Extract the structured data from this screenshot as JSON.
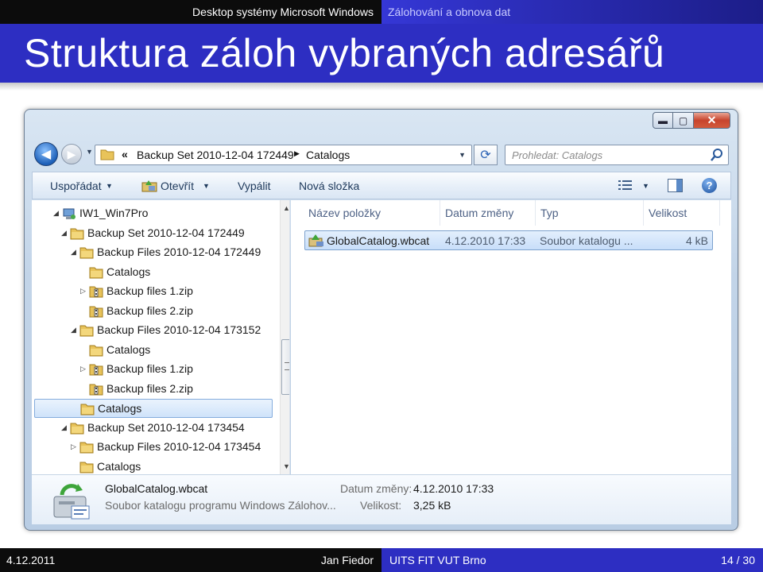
{
  "header": {
    "left_caption": "Desktop systémy Microsoft Windows",
    "right_caption": "Zálohování a obnova dat",
    "title": "Struktura záloh vybraných adresářů"
  },
  "footer": {
    "date": "4.12.2011",
    "author": "Jan Fiedor",
    "institution": "UITS FIT VUT Brno",
    "page": "14 / 30"
  },
  "window": {
    "controls": {
      "minimize": "▬",
      "maximize": "▢",
      "close": "✕"
    },
    "address": {
      "chevron": "«",
      "segment1": "Backup Set 2010-12-04 172449",
      "separator": "▶",
      "segment2": "Catalogs"
    },
    "search_placeholder": "Prohledat: Catalogs",
    "toolbar": {
      "organize": "Uspořádat",
      "open": "Otevřít",
      "burn": "Vypálit",
      "new_folder": "Nová složka"
    },
    "tree": [
      {
        "label": "IW1_Win7Pro",
        "toggle": "◢",
        "icon": "computer-icon"
      },
      {
        "label": "Backup Set 2010-12-04 172449",
        "toggle": "◢",
        "icon": "folder-icon"
      },
      {
        "label": "Backup Files 2010-12-04 172449",
        "toggle": "◢",
        "icon": "folder-icon"
      },
      {
        "label": "Catalogs",
        "toggle": "",
        "icon": "folder-icon"
      },
      {
        "label": "Backup files 1.zip",
        "toggle": "▷",
        "icon": "zip-folder-icon"
      },
      {
        "label": "Backup files 2.zip",
        "toggle": "",
        "icon": "zip-folder-icon"
      },
      {
        "label": "Backup Files 2010-12-04 173152",
        "toggle": "◢",
        "icon": "folder-icon"
      },
      {
        "label": "Catalogs",
        "toggle": "",
        "icon": "folder-icon"
      },
      {
        "label": "Backup files 1.zip",
        "toggle": "▷",
        "icon": "zip-folder-icon"
      },
      {
        "label": "Backup files 2.zip",
        "toggle": "",
        "icon": "zip-folder-icon"
      },
      {
        "label": "Catalogs",
        "toggle": "",
        "icon": "folder-icon",
        "selected": true
      },
      {
        "label": "Backup Set 2010-12-04 173454",
        "toggle": "◢",
        "icon": "folder-icon"
      },
      {
        "label": "Backup Files 2010-12-04 173454",
        "toggle": "▷",
        "icon": "folder-icon"
      },
      {
        "label": "Catalogs",
        "toggle": "",
        "icon": "folder-icon"
      }
    ],
    "columns": {
      "name": "Název položky",
      "date": "Datum změny",
      "type": "Typ",
      "size": "Velikost"
    },
    "file": {
      "name": "GlobalCatalog.wbcat",
      "date": "4.12.2010 17:33",
      "type": "Soubor katalogu ...",
      "size": "4 kB"
    },
    "details": {
      "name": "GlobalCatalog.wbcat",
      "description": "Soubor katalogu programu Windows Záloхov...",
      "date_label": "Datum změny:",
      "date_value": "4.12.2010 17:33",
      "size_label": "Velikost:",
      "size_value": "3,25 kB"
    }
  },
  "colors": {
    "header_blue": "#2d2ec2",
    "black_bar": "#0c0c0c",
    "selection": "#cfe3fa",
    "folder": "#e8c35a"
  }
}
